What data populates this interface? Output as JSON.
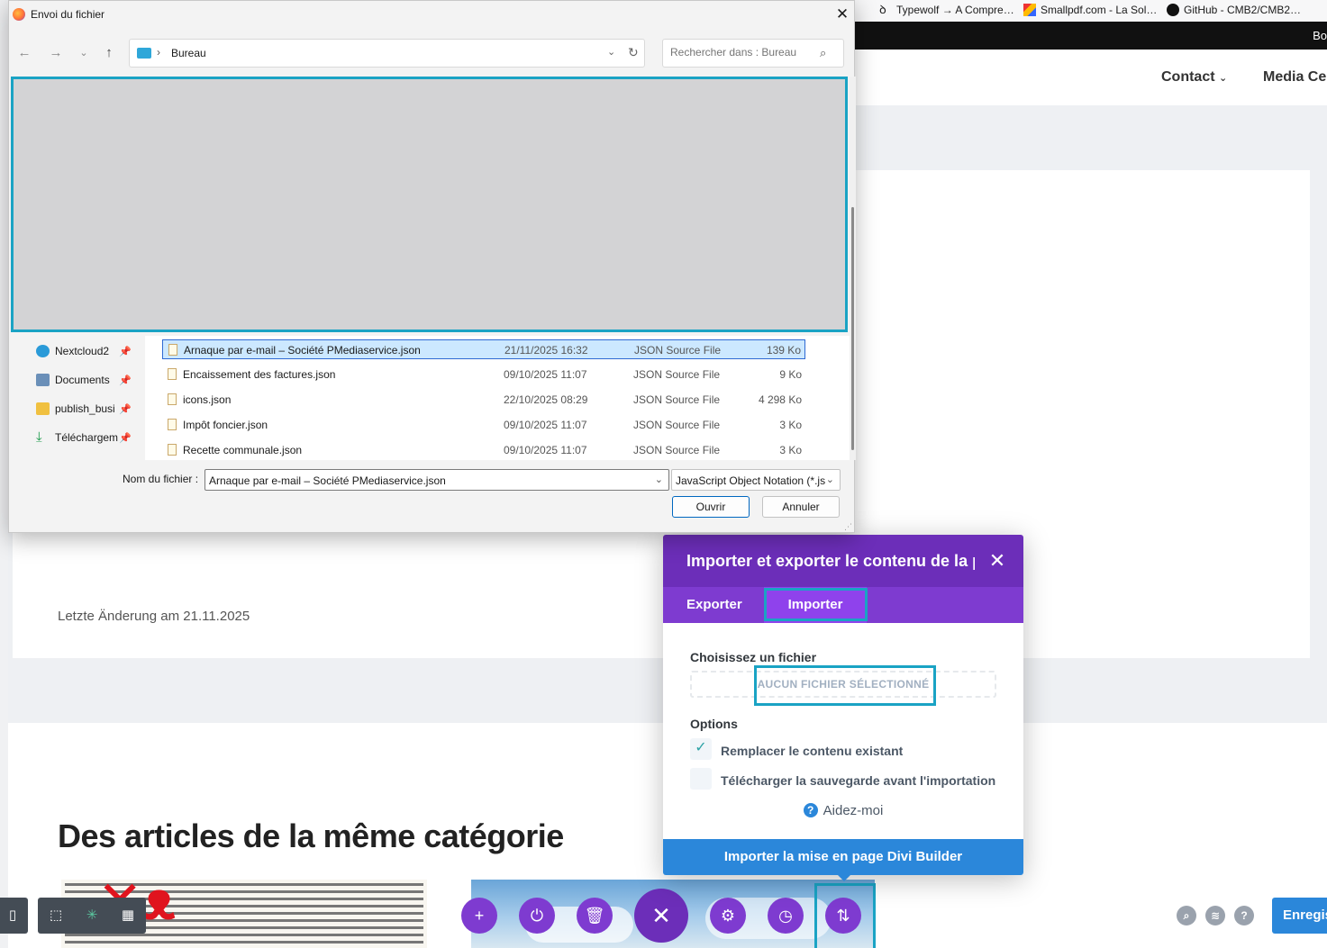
{
  "browser": {
    "bookmarks": [
      {
        "label": "Typewolf → A Compre…"
      },
      {
        "label": "Smallpdf.com - La Sol…"
      },
      {
        "label": "GitHub - CMB2/CMB2…"
      }
    ],
    "black_bar_text": "Bo"
  },
  "site": {
    "nav": [
      "Contact",
      "Media Cen"
    ],
    "last_change": "Letzte Änderung am 21.11.2025",
    "section_title": "Des articles de la même catégorie"
  },
  "file_dialog": {
    "title": "Envoi du fichier",
    "address": "Bureau",
    "search_placeholder": "Rechercher dans : Bureau",
    "nav_items": [
      {
        "label": "Nextcloud2"
      },
      {
        "label": "Documents"
      },
      {
        "label": "publish_busi"
      },
      {
        "label": "Téléchargem"
      }
    ],
    "files": [
      {
        "name": "Arnaque par e-mail – Société PMediaservice.json",
        "date": "21/11/2025 16:32",
        "type": "JSON Source File",
        "size": "139 Ko"
      },
      {
        "name": "Encaissement des factures.json",
        "date": "09/10/2025 11:07",
        "type": "JSON Source File",
        "size": "9 Ko"
      },
      {
        "name": "icons.json",
        "date": "22/10/2025 08:29",
        "type": "JSON Source File",
        "size": "4 298 Ko"
      },
      {
        "name": "Impôt foncier.json",
        "date": "09/10/2025 11:07",
        "type": "JSON Source File",
        "size": "3 Ko"
      },
      {
        "name": "Recette communale.json",
        "date": "09/10/2025 11:07",
        "type": "JSON Source File",
        "size": "3 Ko"
      }
    ],
    "filename_label": "Nom du fichier :",
    "filename_value": "Arnaque par e-mail – Société PMediaservice.json",
    "filetype_value": "JavaScript Object Notation (*.js",
    "open_label": "Ouvrir",
    "cancel_label": "Annuler"
  },
  "divi_modal": {
    "title": "Importer et exporter le contenu de la page",
    "tabs": [
      "Exporter",
      "Importer"
    ],
    "choose_file_label": "Choisissez un fichier",
    "no_file_label": "AUCUN FICHIER SÉLECTIONNÉ",
    "options_label": "Options",
    "option_replace": "Remplacer le contenu existant",
    "option_backup": "Télécharger la sauvegarde avant l'importation",
    "help_label": "Aidez-moi",
    "import_button": "Importer la mise en page Divi Builder"
  },
  "toolbar": {
    "save_label": "Enregistrer"
  },
  "colors": {
    "divi_purple": "#6c2eb9",
    "divi_purple_light": "#7e3bd0",
    "divi_blue": "#2b87da",
    "highlight": "#1aa3c4"
  }
}
